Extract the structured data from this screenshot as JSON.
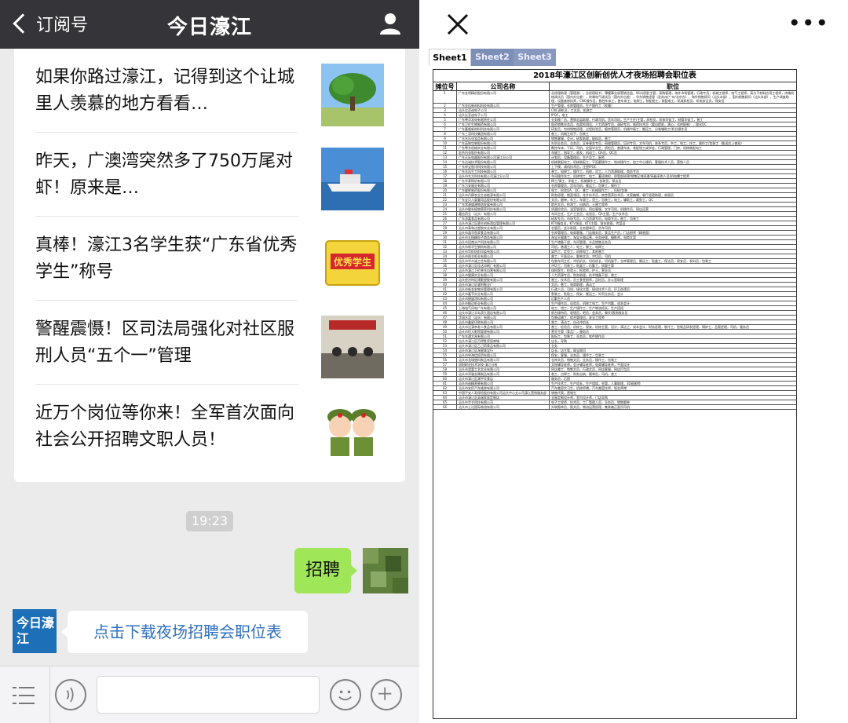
{
  "left": {
    "back_label": "订阅号",
    "title": "今日濠江",
    "articles": [
      {
        "title": "如果你路过濠江，记得到这个让城里人羡慕的地方看看…"
      },
      {
        "title": "昨天，广澳湾突然多了750万尾对虾！原来是…"
      },
      {
        "title": "真棒！濠江3名学生获“广东省优秀学生”称号",
        "thumb_text": "优秀学生"
      },
      {
        "title": "警醒震慑！区司法局强化对社区服刑人员“五个一”管理"
      },
      {
        "title": "近万个岗位等你来！全军首次面向社会公开招聘文职人员！"
      }
    ],
    "timestamp": "19:23",
    "sent_message": "招聘",
    "received_link": "点击下载夜场招聘会职位表",
    "sender_avatar_text": "今日濠江"
  },
  "right": {
    "tabs": [
      "Sheet1",
      "Sheet2",
      "Sheet3"
    ],
    "active_tab": "Sheet1",
    "sheet_title": "2018年濠江区创新创优人才夜场招聘会职位表",
    "headers": [
      "摊位号",
      "公司名称",
      "职位"
    ],
    "rows": [
      [
        "1",
        "广东金明精机股份有限公司",
        "总经理助理（管理类），总经理秘书，薄膜事业部营销总监，W计经理/主管，采购管理，海外市场管理，行政专员，机械工程师，电气工程师，高分子材料应用工程师，终端机械调试员（国内外出差），终端电气调试员（国内外出差），华东销售经理（驻苏州/广州/北京办），海外销售顾问（汕头本部），国内销售顾问（汕头本部），生产调度助理，设备维修技师，CNC操作员，数控车床工，普车床工，电焊工，装配钳工，装配电工，机械质检员，机电安全员，保安员"
      ],
      [
        "2",
        "广东金佳新材料科技有限公司",
        "生产管理，仓库管理员，生产操作工（吹膜）"
      ],
      [
        "3",
        "汕头比亚迪电子公司",
        "CNC调机员，工艺员，机修工"
      ],
      [
        "4",
        "汕头比亚迪电子公司",
        "IPQC，电工"
      ],
      [
        "5",
        "广东粤华发电有限责任公司",
        "业务推广员，营销总监助理，行政司机，货车司机，生产主任/主管，质检员，机修学徒工，制管学徒工，普工"
      ],
      [
        "6",
        "广东卫伦生物制药有限公司",
        "医药销售业务员，血浆检测员，人力资源专员，调研专员，制药技术员（要自提前，满心，试剂配制），理化QC"
      ],
      [
        "7",
        "广东嘉顺新材料科技有限公司",
        "研发员，包材销售经理，过程检验员，细房管理员，机械中级工，搬运工，分装辅助工/机台操作员"
      ],
      [
        "8",
        "广东三凌科技集团有限公司",
        "普工，机械主机手，包装工"
      ],
      [
        "9",
        "广东东乐化妆品有限公司",
        "销售客服，会计，研发助理，配料员，普工"
      ],
      [
        "10",
        "广东英联包装股份有限公司",
        "外贸业务员，业务员，证券事务专员，网络管理员，培训专员，文车司机，体系专员，杂工，电工，技工，操作工/包装工（能适应上夜班）"
      ],
      [
        "11",
        "广东粤东机械实业有限公司",
        "数控车床，下料，司机，应届毕业生，质检员，普通车床，装配钳工或学徒，行政管理，门房，机械装配电工"
      ],
      [
        "12",
        "宏杰内衣股份有限公司",
        "车缝工，指导工，收发，机动工，QA员，QC员"
      ],
      [
        "13",
        "广东天际电器股份有限公司濠江分公司",
        "计划员，设备管理员，生产员工，厨师"
      ],
      [
        "14",
        "广东达诚技术股份有限公司",
        "机械装配电工，机械装配工，平面磨操作工，铣床操作工，加工中心操机，客服技术人员，营销人员"
      ],
      [
        "15",
        "广东祥宝智讯科技有限公司",
        "上下模，调机技术员，注塑IPQC"
      ],
      [
        "16",
        "广东东泓生工科技有限公司",
        "普工，电焊工，操作工，机修，泥工，人力资源助理，商务专员"
      ],
      [
        "17",
        "汕头市东方科技有限公司濠江分公司",
        "车间操作技工，机修钳工，电工，蓄班统检，质管部经理/销售区域经理/高级采购人员/机电爆工程师"
      ],
      [
        "18",
        "广东华泰铸机有限公司",
        "焊工/铆工，学徒工，机械操作工，包装员，保洁员"
      ],
      [
        "19",
        "广东万安福业有限公司",
        "仓库管理员，货车司机，搬运工，包装工，操作工"
      ],
      [
        "20",
        "广东健辉制药股份有限公司",
        "电工，检验QA，QC，普工（机械操作工），目检/包装"
      ],
      [
        "21",
        "汕头市丹穆农业生态能源有限公司",
        "财务经理，楼面领班，花卉技术员，商昔营养技术员，文案编辑，餐厅经理助理，收银员"
      ],
      [
        "22",
        "广东宝贝儿婴童用品股份有限公司",
        "文员，跟单，车工，车版工，烫工，包装工，电工，辅助工，裁剪工，QC"
      ],
      [
        "23",
        "广东常源盛源物流发展有限公司",
        "前台文员，检测工，出纳员，土建工程师"
      ],
      [
        "24",
        "汕头市健补植物营养科技有限公司",
        "质量检验员，温室管理员，网店客服，叉车司机，机操作员，网店运营"
      ],
      [
        "25",
        "嘉信药业（汕头）有限公司",
        "车间主任，生产工艺员，化验员，QA主管，生产技术员"
      ],
      [
        "26",
        "广东添嘉食品有限公司",
        "研发专员，市场专员，人力资源专员，电商专员，普工，包装工"
      ],
      [
        "27",
        "汕头市濠江区碧丰创新酒店管理有限公司",
        "KTV服务员，KTV领班，KTV主管，前台收银，传菜员"
      ],
      [
        "28",
        "汕头市泰和达塑胶实业有限公司",
        "仓管员，会计助理，业务跟单员，货车司机"
      ],
      [
        "29",
        "汕头市晶华鱼浆食品有限公司",
        "仓库管理员，电商客服，门店服务员，食品生产员，门店厨师（精香面）"
      ],
      [
        "30",
        "汕头市五指峰电子商务有限公司",
        "淘宝天猫美工，淘宝天猫运营，业务经理，摄影师，电商文案"
      ],
      [
        "31",
        "汕头市班商水产科技有限公司",
        "生产储备干部，车间管理，水品销售业务员"
      ],
      [
        "32",
        "汕头市新华生钢构有限公司",
        "司机，普通工人，电工，铆工，电焊工"
      ],
      [
        "33",
        "汕头市华织纺织印染有限公司",
        "染色工，定型工，机修电工，其他普工"
      ],
      [
        "34",
        "汕头市裕丰纸业有限公司",
        "普工，平面设计，跟单文员，冲切员，司机"
      ],
      [
        "35",
        "汕头市华众诚工艺有限公司",
        "包装车间主任，冲机机长，切机机长，切机副手，仓库管理员，搬运工，贴盒工，保洁员，保安员，发料员，包装工"
      ],
      [
        "36",
        "汕头市濠江区佳达印刷厂有限公司",
        "冲切工，包装工，贴盒工，后勤工，质量主管"
      ],
      [
        "37",
        "汕头市濠江卫伦单车自营有限公司",
        "体检医生，检验士，检验师，护士，营业员"
      ],
      [
        "38",
        "汕头市健康实业有限公司",
        "人力资源专员，财务助理，技术储备干部，普工"
      ],
      [
        "39",
        "汕头经济特区建勤塑胶有限公司",
        "普工，技术员，员工食堂厨师，品检员，办公室助理"
      ],
      [
        "40",
        "汕头市濠江区骏利鞋业厂",
        "文员，普工，电商助理，清洁工"
      ],
      [
        "41",
        "汕头市新金安物业管理有限公司",
        "行政人员，司机，绿化主管，绿化技术人员，环卫巡逻员"
      ],
      [
        "42",
        "汕头市嘉亨实业有限公司",
        "割装工，贴贴工，保安，搬运工，外贸业务员，会计"
      ],
      [
        "43",
        "汕头市捷盛涂料有限公司",
        "后勤生产人员"
      ],
      [
        "44",
        "汕头市楷达纸业有限公司",
        "生产操作员，化验员，机修工电工，生产内勤，成本会计"
      ],
      [
        "45",
        "上海电气风电广东有限公司",
        "电工，钳工，生产操作工，生产物流组长，生产班组"
      ],
      [
        "46",
        "汕头市濠江半岛滨大酒店有限公司",
        "前台接待员，收银员，吧员，会务员，餐饮/客房服务员"
      ],
      [
        "47",
        "华润水泥（汕头）有限公司",
        "包装运输工，综合管理员，安全工程师"
      ],
      [
        "48",
        "汕头市鑫星印刷有限公司",
        "普工，清洁工，自动冲机长"
      ],
      [
        "49",
        "汕头市达濠李老二食品有限公司",
        "普工，检验员，机修工，保安，机修主管，设计，清洁工，成本会计，财务经理，制冷工，鱼制品研发经理，锅炉工，品管经理，司机，服务员"
      ],
      [
        "50",
        "汕头市恒大影院管理有限公司",
        "营业主管（食品），服务员"
      ],
      [
        "51",
        "广东东通文具有限公司",
        "贴标工，包装工，业务员，软件操作员"
      ],
      [
        "52",
        "汕头市濠江区百得胜家居商城",
        "店长，导购"
      ],
      [
        "53",
        "汕头市濠江区乙己荷食品有限公司",
        "业务"
      ],
      [
        "54",
        "汕头市濠江区淘星珠宝行",
        "店长，店主管，珠宝顾问"
      ],
      [
        "55",
        "汕头市申海信投资有限公司",
        "保安，客服，业务员，操作工，包装工"
      ],
      [
        "56",
        "汕头市龙瑞塑料制品有限公司",
        "仓库文员，销售文员，业务员，操作工，包装工"
      ],
      [
        "57",
        "旭阳职业技术学校-濠江分校",
        "文秘辅导老师，会计辅导老师，电商辅导老师，平面设计"
      ],
      [
        "58",
        "汕头市澄富工艺实业有限公司",
        "网店美工，销售文员，行政文员，网店客服，网店打包员"
      ],
      [
        "59",
        "汕头市添骏金属制品有限公司",
        "普工，点焊工，财务出纳，跟单员，司机，普工"
      ],
      [
        "60",
        "汕头市濠江区渊宇饮食店",
        "服务员，后厨"
      ],
      [
        "61",
        "汕头市迪精养殖有限公司",
        "生产技术工，生产组长，生产组组，仓管，人事助理，3D画图师"
      ],
      [
        "62",
        "汕头市安民汽车维修有限公司",
        "汽车美容实习生，机修师傅，汽车美容技师，钣金师傅"
      ],
      [
        "63",
        "中国平安人寿保险股份有限公司汕头中心支公司濠江营销服务部",
        "销售代表，营销生"
      ],
      [
        "64",
        "汕头市濠江区英瑞家居定制店",
        "全屋定制设计师，室内设计师，门店导购"
      ],
      [
        "65",
        "汕头市华仑科技有限公司",
        "电子工程师，技术员，工厂管理人员，业务员，销售跟单"
      ],
      [
        "66",
        "汕头市土达国际物流有限公司",
        "外联跟单员，报关员，物流运营经理，集装箱正面吊司机"
      ]
    ]
  }
}
